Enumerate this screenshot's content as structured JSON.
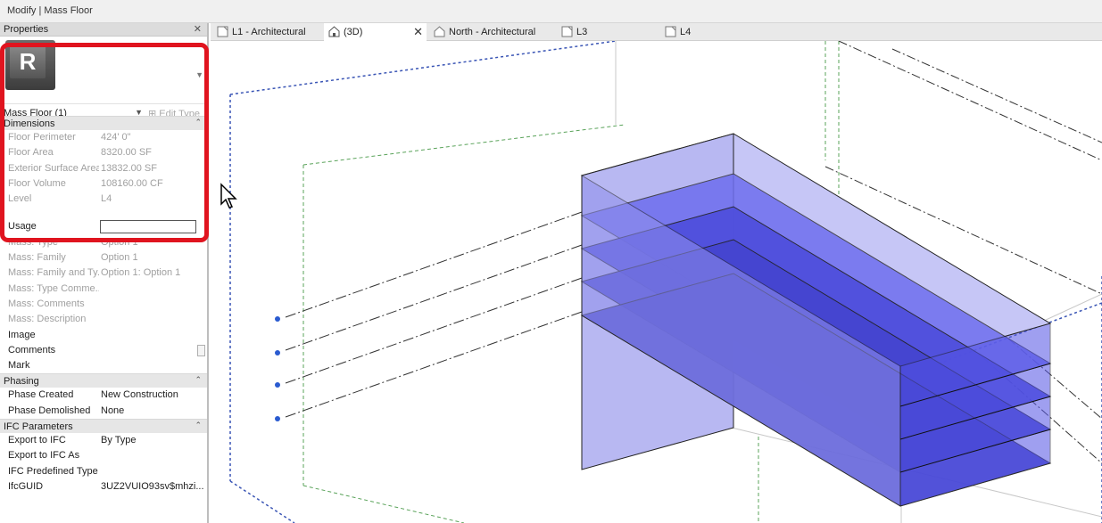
{
  "window": {
    "title": "Modify | Mass Floor"
  },
  "properties": {
    "header": "Properties",
    "close_glyph": "✕",
    "logo_letter": "R",
    "type_selector": "Mass Floor (1)",
    "edit_type": "Edit Type",
    "groups": {
      "dimensions": "Dimensions",
      "phasing": "Phasing",
      "ifc": "IFC Parameters"
    },
    "dimensions": [
      {
        "name": "Floor Perimeter",
        "value": "424'  0\""
      },
      {
        "name": "Floor Area",
        "value": "8320.00 SF"
      },
      {
        "name": "Exterior Surface Area",
        "value": "13832.00 SF"
      },
      {
        "name": "Floor Volume",
        "value": "108160.00 CF"
      },
      {
        "name": "Level",
        "value": "L4"
      }
    ],
    "identity": [
      {
        "name": "Usage",
        "value": ""
      },
      {
        "name": "Mass: Type",
        "value": "Option 1"
      },
      {
        "name": "Mass: Family",
        "value": "Option 1"
      },
      {
        "name": "Mass: Family and Ty...",
        "value": "Option 1: Option 1"
      },
      {
        "name": "Mass: Type Comme...",
        "value": ""
      },
      {
        "name": "Mass: Comments",
        "value": ""
      },
      {
        "name": "Mass: Description",
        "value": ""
      },
      {
        "name": "Image",
        "value": ""
      },
      {
        "name": "Comments",
        "value": ""
      },
      {
        "name": "Mark",
        "value": ""
      }
    ],
    "phasing": [
      {
        "name": "Phase Created",
        "value": "New Construction"
      },
      {
        "name": "Phase Demolished",
        "value": "None"
      }
    ],
    "ifc": [
      {
        "name": "Export to IFC",
        "value": "By Type"
      },
      {
        "name": "Export to IFC As",
        "value": ""
      },
      {
        "name": "IFC Predefined Type",
        "value": ""
      },
      {
        "name": "IfcGUID",
        "value": "3UZ2VUIO93sv$mhzi..."
      }
    ]
  },
  "tabs": [
    {
      "label": "L1 - Architectural",
      "icon": "floor-plan-icon",
      "active": false
    },
    {
      "label": "(3D)",
      "icon": "3d-house-icon",
      "active": true,
      "close": "✕"
    },
    {
      "label": "North - Architectural",
      "icon": "elevation-house-icon",
      "active": false
    },
    {
      "label": "L3",
      "icon": "floor-plan-icon",
      "active": false
    },
    {
      "label": "L4",
      "icon": "floor-plan-icon",
      "active": false
    }
  ],
  "viewport": {
    "mass_color": "#5a5ae6",
    "level_marker_count": 4
  }
}
